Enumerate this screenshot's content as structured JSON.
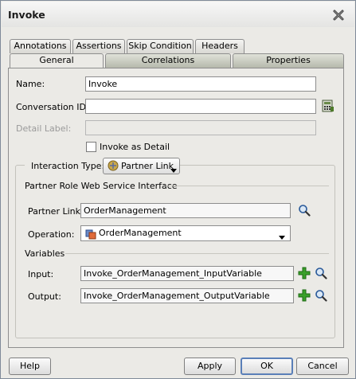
{
  "window": {
    "title": "Invoke"
  },
  "tabs_row1": [
    "Annotations",
    "Assertions",
    "Skip Condition",
    "Headers"
  ],
  "tabs_row2": [
    "General",
    "Correlations",
    "Properties"
  ],
  "form": {
    "name_label": "Name:",
    "name_value": "Invoke",
    "conversation_label": "Conversation ID:",
    "conversation_value": "",
    "detail_label": "Detail Label:",
    "detail_value": "",
    "invoke_as_detail_label": "Invoke as Detail",
    "invoke_as_detail_checked": false
  },
  "interaction": {
    "label": "Interaction Type:",
    "value": "Partner Link"
  },
  "partner_role": {
    "section_title": "Partner Role Web Service Interface",
    "partner_link_label": "Partner Link:",
    "partner_link_value": "OrderManagement",
    "operation_label": "Operation:",
    "operation_value": "OrderManagement"
  },
  "variables": {
    "section_title": "Variables",
    "input_label": "Input:",
    "input_value": "Invoke_OrderManagement_InputVariable",
    "output_label": "Output:",
    "output_value": "Invoke_OrderManagement_OutputVariable"
  },
  "buttons": {
    "help": "Help",
    "apply": "Apply",
    "ok": "OK",
    "cancel": "Cancel"
  },
  "colors": {
    "dialog_bg": "#ebeae6",
    "default_button_border": "#5a7fb8",
    "add_icon": "#3aa02a"
  }
}
